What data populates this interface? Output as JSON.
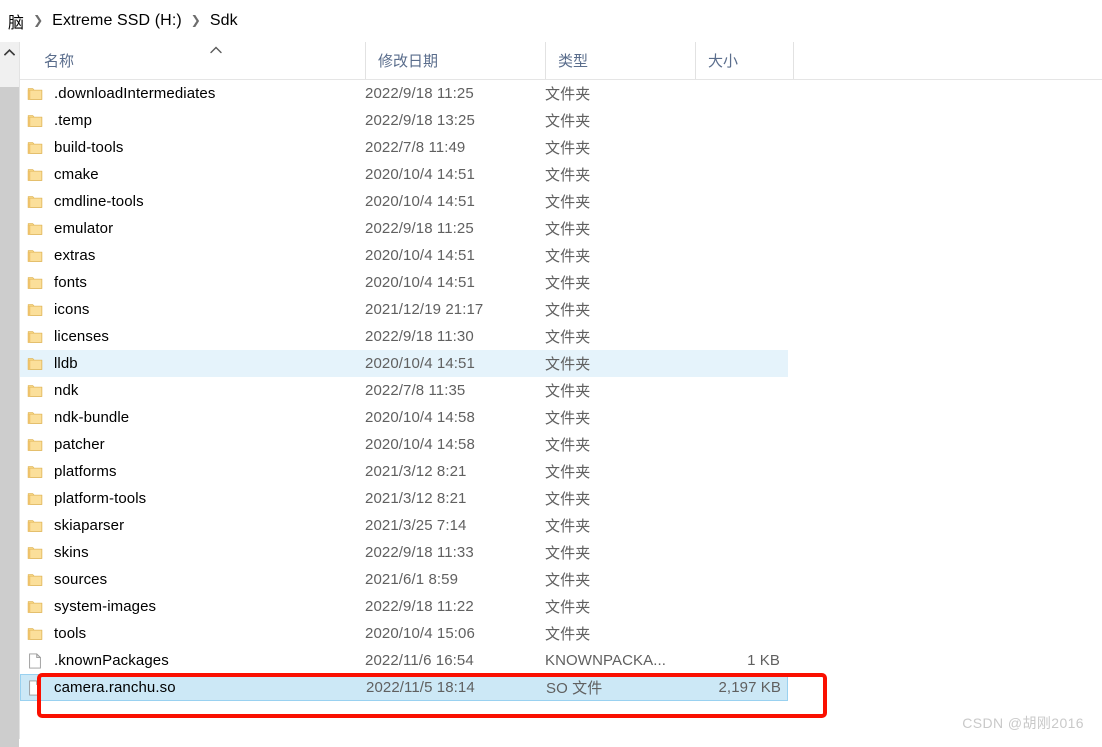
{
  "breadcrumb": {
    "items": [
      "脑",
      "Extreme SSD (H:)",
      "Sdk"
    ],
    "separator": "❯"
  },
  "columns": {
    "name": "名称",
    "date_modified": "修改日期",
    "type": "类型",
    "size": "大小",
    "sort_indicator": "ascending-caret"
  },
  "icons": {
    "scroll_up": "chevron-up-icon",
    "folder": "folder-icon",
    "file": "file-icon",
    "sort": "caret-up-icon"
  },
  "colors": {
    "selection": "#cce8f6",
    "selection_border": "#99d1f0",
    "hover": "#e5f3fb",
    "annotation": "#fa0f00",
    "header_text": "#5a6d8c",
    "folder": "#f7d27a",
    "watermark": "#c9c9c9"
  },
  "rows": [
    {
      "name": ".downloadIntermediates",
      "date": "2022/9/18 11:25",
      "type": "文件夹",
      "size": "",
      "icon": "folder",
      "state": "normal"
    },
    {
      "name": ".temp",
      "date": "2022/9/18 13:25",
      "type": "文件夹",
      "size": "",
      "icon": "folder",
      "state": "normal"
    },
    {
      "name": "build-tools",
      "date": "2022/7/8 11:49",
      "type": "文件夹",
      "size": "",
      "icon": "folder",
      "state": "normal"
    },
    {
      "name": "cmake",
      "date": "2020/10/4 14:51",
      "type": "文件夹",
      "size": "",
      "icon": "folder",
      "state": "normal"
    },
    {
      "name": "cmdline-tools",
      "date": "2020/10/4 14:51",
      "type": "文件夹",
      "size": "",
      "icon": "folder",
      "state": "normal"
    },
    {
      "name": "emulator",
      "date": "2022/9/18 11:25",
      "type": "文件夹",
      "size": "",
      "icon": "folder",
      "state": "normal"
    },
    {
      "name": "extras",
      "date": "2020/10/4 14:51",
      "type": "文件夹",
      "size": "",
      "icon": "folder",
      "state": "normal"
    },
    {
      "name": "fonts",
      "date": "2020/10/4 14:51",
      "type": "文件夹",
      "size": "",
      "icon": "folder",
      "state": "normal"
    },
    {
      "name": "icons",
      "date": "2021/12/19 21:17",
      "type": "文件夹",
      "size": "",
      "icon": "folder",
      "state": "normal"
    },
    {
      "name": "licenses",
      "date": "2022/9/18 11:30",
      "type": "文件夹",
      "size": "",
      "icon": "folder",
      "state": "normal"
    },
    {
      "name": "lldb",
      "date": "2020/10/4 14:51",
      "type": "文件夹",
      "size": "",
      "icon": "folder",
      "state": "hovered"
    },
    {
      "name": "ndk",
      "date": "2022/7/8 11:35",
      "type": "文件夹",
      "size": "",
      "icon": "folder",
      "state": "normal"
    },
    {
      "name": "ndk-bundle",
      "date": "2020/10/4 14:58",
      "type": "文件夹",
      "size": "",
      "icon": "folder",
      "state": "normal"
    },
    {
      "name": "patcher",
      "date": "2020/10/4 14:58",
      "type": "文件夹",
      "size": "",
      "icon": "folder",
      "state": "normal"
    },
    {
      "name": "platforms",
      "date": "2021/3/12 8:21",
      "type": "文件夹",
      "size": "",
      "icon": "folder",
      "state": "normal"
    },
    {
      "name": "platform-tools",
      "date": "2021/3/12 8:21",
      "type": "文件夹",
      "size": "",
      "icon": "folder",
      "state": "normal"
    },
    {
      "name": "skiaparser",
      "date": "2021/3/25 7:14",
      "type": "文件夹",
      "size": "",
      "icon": "folder",
      "state": "normal"
    },
    {
      "name": "skins",
      "date": "2022/9/18 11:33",
      "type": "文件夹",
      "size": "",
      "icon": "folder",
      "state": "normal"
    },
    {
      "name": "sources",
      "date": "2021/6/1 8:59",
      "type": "文件夹",
      "size": "",
      "icon": "folder",
      "state": "normal"
    },
    {
      "name": "system-images",
      "date": "2022/9/18 11:22",
      "type": "文件夹",
      "size": "",
      "icon": "folder",
      "state": "normal"
    },
    {
      "name": "tools",
      "date": "2020/10/4 15:06",
      "type": "文件夹",
      "size": "",
      "icon": "folder",
      "state": "normal"
    },
    {
      "name": ".knownPackages",
      "date": "2022/11/6 16:54",
      "type": "KNOWNPACKA...",
      "size": "1 KB",
      "icon": "file",
      "state": "normal"
    },
    {
      "name": "camera.ranchu.so",
      "date": "2022/11/5 18:14",
      "type": "SO 文件",
      "size": "2,197 KB",
      "icon": "file",
      "state": "selected"
    }
  ],
  "watermark": "CSDN @胡刚2016"
}
